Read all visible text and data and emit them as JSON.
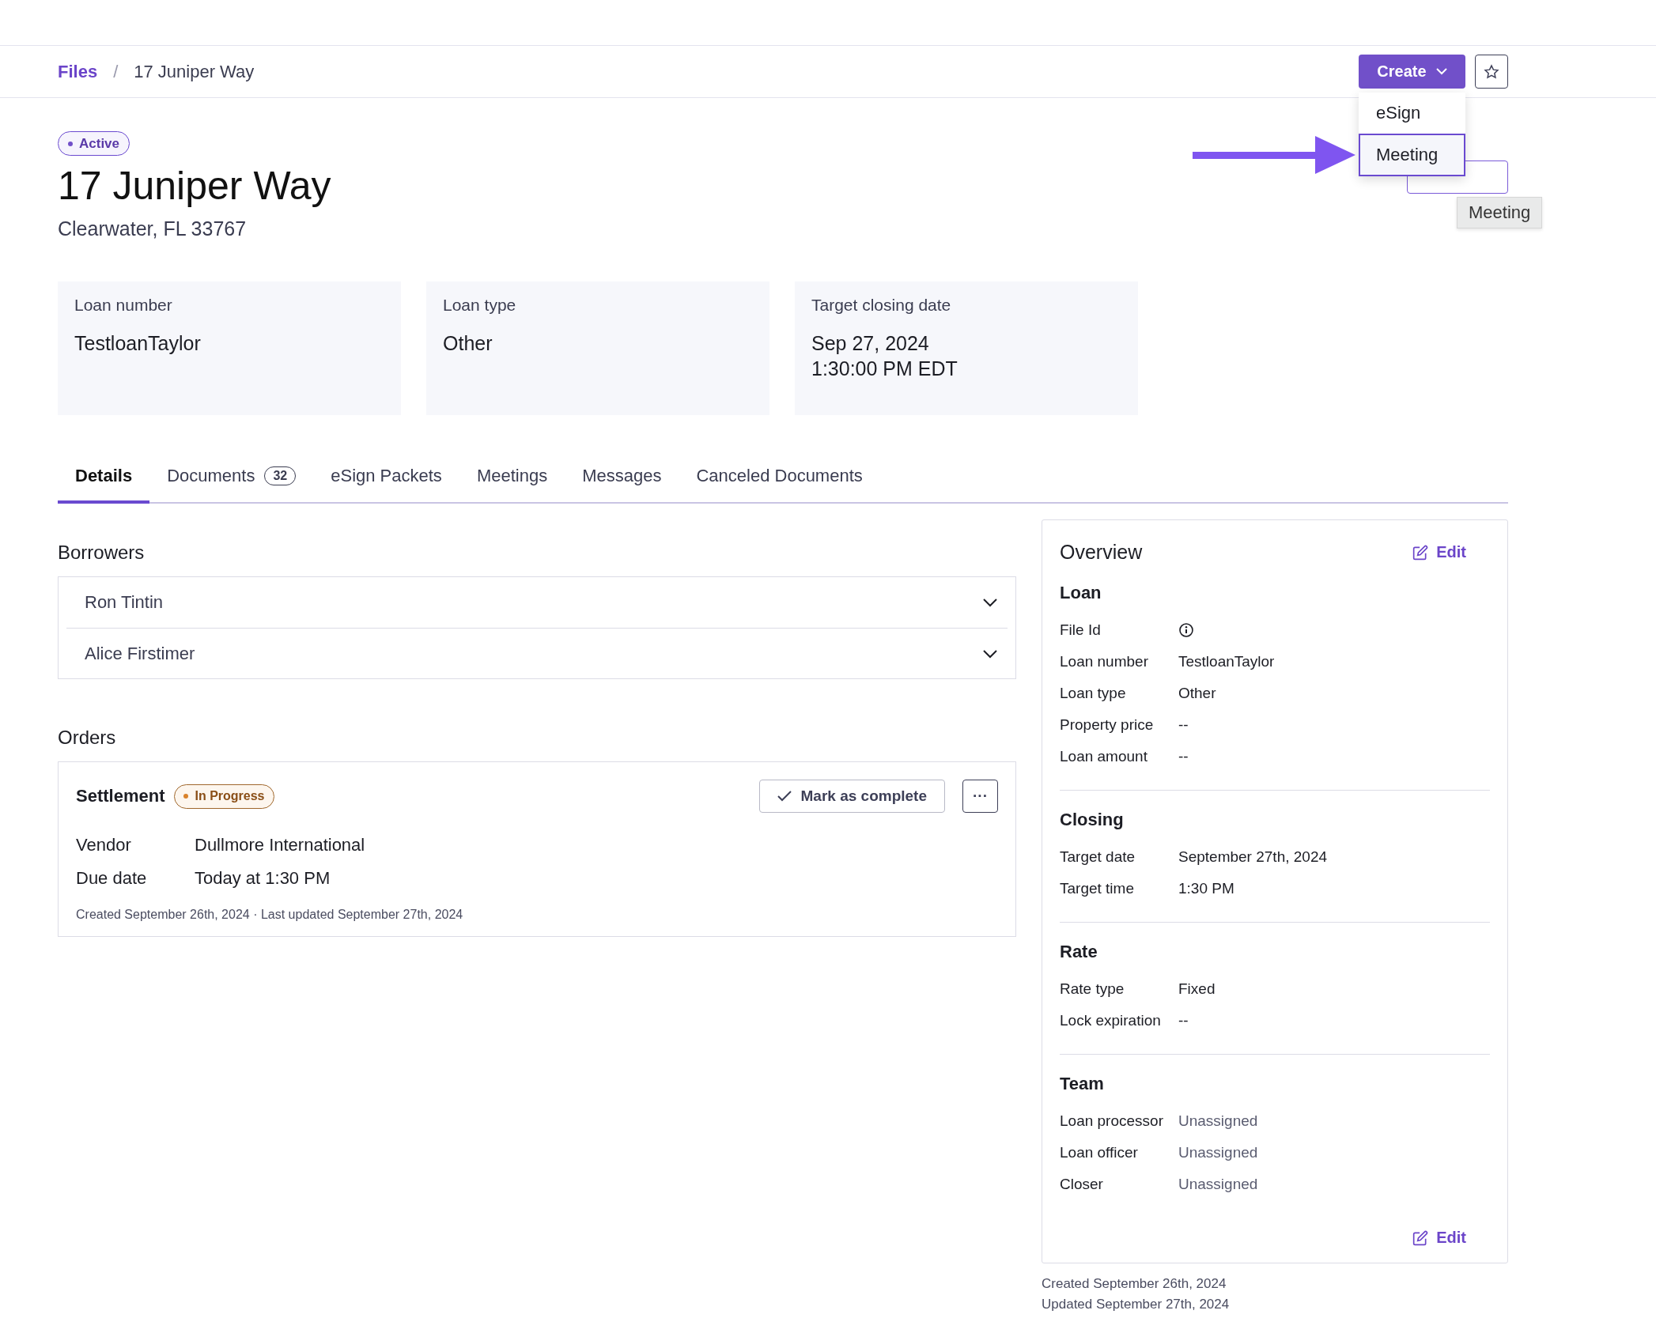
{
  "breadcrumb": {
    "items": [
      {
        "label": "Files",
        "link": true
      },
      {
        "label": "17 Juniper Way",
        "link": false
      }
    ],
    "separator": "/"
  },
  "create_button": {
    "label": "Create"
  },
  "create_menu": {
    "items": [
      {
        "label": "eSign",
        "selected": false
      },
      {
        "label": "Meeting",
        "selected": true
      }
    ]
  },
  "tooltip": "Meeting",
  "status_badge": "Active",
  "title": "17 Juniper Way",
  "subtitle": "Clearwater, FL 33767",
  "summary_cards": [
    {
      "label": "Loan number",
      "lines": [
        "TestloanTaylor"
      ]
    },
    {
      "label": "Loan type",
      "lines": [
        "Other"
      ]
    },
    {
      "label": "Target closing date",
      "lines": [
        "Sep 27, 2024",
        "1:30:00 PM EDT"
      ]
    }
  ],
  "tabs": [
    {
      "label": "Details",
      "selected": true
    },
    {
      "label": "Documents",
      "count": "32",
      "selected": false
    },
    {
      "label": "eSign Packets",
      "selected": false
    },
    {
      "label": "Meetings",
      "selected": false
    },
    {
      "label": "Messages",
      "selected": false
    },
    {
      "label": "Canceled Documents",
      "selected": false
    }
  ],
  "borrowers": {
    "title": "Borrowers",
    "items": [
      {
        "name": "Ron Tintin",
        "expanded": false
      },
      {
        "name": "Alice Firstimer",
        "expanded": false
      }
    ]
  },
  "orders": {
    "title": "Orders",
    "items": [
      {
        "name": "Settlement",
        "status": "In Progress",
        "complete_label": "Mark as complete",
        "more_label": "···",
        "fields": [
          {
            "label": "Vendor",
            "value": "Dullmore International"
          },
          {
            "label": "Due date",
            "value": "Today at 1:30 PM"
          }
        ],
        "meta": "Created September 26th, 2024 · Last updated September 27th, 2024"
      }
    ]
  },
  "overview": {
    "title": "Overview",
    "edit_label": "Edit",
    "bottom_edit_label": "Edit",
    "sections": [
      {
        "title": "Loan",
        "rows": [
          {
            "label": "File Id",
            "kind": "info"
          },
          {
            "label": "Loan number",
            "value": "TestloanTaylor",
            "kind": "text"
          },
          {
            "label": "Loan type",
            "value": "Other",
            "kind": "text"
          },
          {
            "label": "Property price",
            "value": "--",
            "kind": "text"
          },
          {
            "label": "Loan amount",
            "value": "--",
            "kind": "text"
          }
        ]
      },
      {
        "title": "Closing",
        "rows": [
          {
            "label": "Target date",
            "value": "September 27th, 2024",
            "kind": "text"
          },
          {
            "label": "Target time",
            "value": "1:30 PM",
            "kind": "text"
          }
        ]
      },
      {
        "title": "Rate",
        "rows": [
          {
            "label": "Rate type",
            "value": "Fixed",
            "kind": "text"
          },
          {
            "label": "Lock expiration",
            "value": "--",
            "kind": "text"
          }
        ]
      },
      {
        "title": "Team",
        "rows": [
          {
            "label": "Loan processor",
            "value": "Unassigned",
            "kind": "muted"
          },
          {
            "label": "Loan officer",
            "value": "Unassigned",
            "kind": "muted"
          },
          {
            "label": "Closer",
            "value": "Unassigned",
            "kind": "muted"
          }
        ]
      }
    ]
  },
  "footer": [
    "Created September 26th, 2024",
    "Updated September 27th, 2024"
  ]
}
